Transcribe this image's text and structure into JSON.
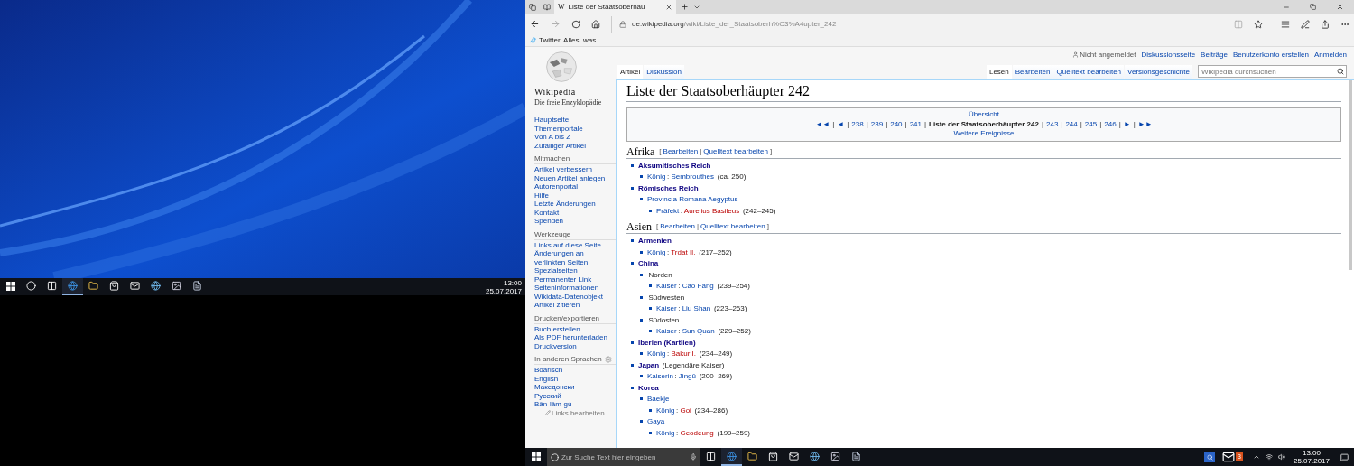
{
  "desktop": {
    "taskbar": {
      "icons": [
        {
          "kind": "start",
          "selected": false
        },
        {
          "kind": "cortana",
          "selected": false
        },
        {
          "kind": "taskview",
          "selected": false
        },
        {
          "kind": "edge",
          "selected": true
        },
        {
          "kind": "explorer",
          "selected": false
        },
        {
          "kind": "store",
          "selected": false
        },
        {
          "kind": "mail",
          "selected": false
        },
        {
          "kind": "ie",
          "selected": false
        },
        {
          "kind": "app",
          "selected": false
        },
        {
          "kind": "notepad",
          "selected": false
        }
      ],
      "time": "13:00",
      "date": "25.07.2017"
    }
  },
  "browser": {
    "tab": {
      "favicon": "W",
      "title": "Liste der Staatsoberhäu"
    },
    "address": {
      "domain": "de.wikipedia.org",
      "path": "/wiki/Liste_der_Staatsoberh%C3%A4upter_242"
    },
    "favorites": [
      {
        "label": "Twitter. Alles, was"
      }
    ]
  },
  "wiki": {
    "wordmark": "Wikipedia",
    "tagline": "Die freie Enzyklopädie",
    "personal": [
      {
        "label": "Nicht angemeldet",
        "kind": "user"
      },
      {
        "label": "Diskussionsseite",
        "kind": "link"
      },
      {
        "label": "Beiträge",
        "kind": "link"
      },
      {
        "label": "Benutzerkonto erstellen",
        "kind": "link"
      },
      {
        "label": "Anmelden",
        "kind": "link"
      }
    ],
    "left_tabs": [
      {
        "label": "Artikel",
        "selected": true
      },
      {
        "label": "Diskussion",
        "selected": false
      }
    ],
    "right_tabs": [
      {
        "label": "Lesen",
        "selected": true
      },
      {
        "label": "Bearbeiten",
        "selected": false
      },
      {
        "label": "Quelltext bearbeiten",
        "selected": false
      },
      {
        "label": "Versionsgeschichte",
        "selected": false
      }
    ],
    "search": {
      "placeholder": "Wikipedia durchsuchen"
    },
    "sidebar": [
      {
        "items": [
          "Hauptseite",
          "Themenportale",
          "Von A bis Z",
          "Zufälliger Artikel"
        ]
      },
      {
        "heading": "Mitmachen",
        "items": [
          "Artikel verbessern",
          "Neuen Artikel anlegen",
          "Autorenportal",
          "Hilfe",
          "Letzte Änderungen",
          "Kontakt",
          "Spenden"
        ]
      },
      {
        "heading": "Werkzeuge",
        "items": [
          "Links auf diese Seite",
          "Änderungen an verlinkten Seiten",
          "Spezialseiten",
          "Permanenter Link",
          "Seiteninformationen",
          "Wikidata-Datenobjekt",
          "Artikel zitieren"
        ]
      },
      {
        "heading": "Drucken/exportieren",
        "items": [
          "Buch erstellen",
          "Als PDF herunterladen",
          "Druckversion"
        ]
      },
      {
        "heading": "In anderen Sprachen",
        "gear": true,
        "items": [
          "Boarisch",
          "English",
          "Македонски",
          "Русский",
          "Bân-lâm-gú"
        ],
        "footer": "Links bearbeiten"
      }
    ],
    "title": "Liste der Staatsoberhäupter 242",
    "navbox": {
      "top": "Übersicht",
      "items": [
        {
          "text": "◄◄",
          "kind": "link"
        },
        {
          "text": "|",
          "kind": "sep"
        },
        {
          "text": "◄",
          "kind": "link"
        },
        {
          "text": "|",
          "kind": "sep"
        },
        {
          "text": "238",
          "kind": "link"
        },
        {
          "text": "|",
          "kind": "sep"
        },
        {
          "text": "239",
          "kind": "link"
        },
        {
          "text": "|",
          "kind": "sep"
        },
        {
          "text": "240",
          "kind": "link"
        },
        {
          "text": "|",
          "kind": "sep"
        },
        {
          "text": "241",
          "kind": "link"
        },
        {
          "text": "|",
          "kind": "sep"
        },
        {
          "text": "Liste der Staatsoberhäupter 242",
          "kind": "current"
        },
        {
          "text": "|",
          "kind": "sep"
        },
        {
          "text": "243",
          "kind": "link"
        },
        {
          "text": "|",
          "kind": "sep"
        },
        {
          "text": "244",
          "kind": "link"
        },
        {
          "text": "|",
          "kind": "sep"
        },
        {
          "text": "245",
          "kind": "link"
        },
        {
          "text": "|",
          "kind": "sep"
        },
        {
          "text": "246",
          "kind": "link"
        },
        {
          "text": "|",
          "kind": "sep"
        },
        {
          "text": "►",
          "kind": "link"
        },
        {
          "text": "|",
          "kind": "sep"
        },
        {
          "text": "►►",
          "kind": "link"
        }
      ],
      "bottom": "Weitere Ereignisse"
    },
    "sections": [
      {
        "heading": "Afrika",
        "edit": [
          {
            "text": "[",
            "kind": "text"
          },
          {
            "text": "Bearbeiten",
            "kind": "link"
          },
          {
            "text": "|",
            "kind": "text"
          },
          {
            "text": "Quelltext bearbeiten",
            "kind": "link"
          },
          {
            "text": "]",
            "kind": "text"
          }
        ],
        "items": [
          {
            "parts": [
              {
                "text": "Aksumitisches Reich",
                "kind": "bold"
              }
            ],
            "children": [
              {
                "parts": [
                  {
                    "text": "König",
                    "kind": "link"
                  },
                  {
                    "text": ": ",
                    "kind": "text"
                  },
                  {
                    "text": "Sembrouthes",
                    "kind": "link"
                  },
                  {
                    "text": " (ca. 250)",
                    "kind": "text"
                  }
                ]
              }
            ]
          },
          {
            "parts": [
              {
                "text": "Römisches Reich",
                "kind": "bold"
              }
            ],
            "children": [
              {
                "parts": [
                  {
                    "text": "Provincia Romana Aegyptus",
                    "kind": "link"
                  }
                ],
                "children": [
                  {
                    "parts": [
                      {
                        "text": "Präfekt",
                        "kind": "link"
                      },
                      {
                        "text": ": ",
                        "kind": "text"
                      },
                      {
                        "text": "Aurelius Basileus",
                        "kind": "red"
                      },
                      {
                        "text": " (242–245)",
                        "kind": "text"
                      }
                    ]
                  }
                ]
              }
            ]
          }
        ]
      },
      {
        "heading": "Asien",
        "edit": [
          {
            "text": "[",
            "kind": "text"
          },
          {
            "text": "Bearbeiten",
            "kind": "link"
          },
          {
            "text": "|",
            "kind": "text"
          },
          {
            "text": "Quelltext bearbeiten",
            "kind": "link"
          },
          {
            "text": "]",
            "kind": "text"
          }
        ],
        "items": [
          {
            "parts": [
              {
                "text": "Armenien",
                "kind": "bold"
              }
            ],
            "children": [
              {
                "parts": [
                  {
                    "text": "König",
                    "kind": "link"
                  },
                  {
                    "text": ": ",
                    "kind": "text"
                  },
                  {
                    "text": "Trdat II.",
                    "kind": "red"
                  },
                  {
                    "text": " (217–252)",
                    "kind": "text"
                  }
                ]
              }
            ]
          },
          {
            "parts": [
              {
                "text": "China",
                "kind": "bold"
              }
            ],
            "children": [
              {
                "parts": [
                  {
                    "text": "Norden",
                    "kind": "text"
                  }
                ],
                "children": [
                  {
                    "parts": [
                      {
                        "text": "Kaiser",
                        "kind": "link"
                      },
                      {
                        "text": ": ",
                        "kind": "text"
                      },
                      {
                        "text": "Cao Fang",
                        "kind": "link"
                      },
                      {
                        "text": " (239–254)",
                        "kind": "text"
                      }
                    ]
                  }
                ]
              },
              {
                "parts": [
                  {
                    "text": "Südwesten",
                    "kind": "text"
                  }
                ],
                "children": [
                  {
                    "parts": [
                      {
                        "text": "Kaiser",
                        "kind": "link"
                      },
                      {
                        "text": ": ",
                        "kind": "text"
                      },
                      {
                        "text": "Liu Shan",
                        "kind": "link"
                      },
                      {
                        "text": " (223–263)",
                        "kind": "text"
                      }
                    ]
                  }
                ]
              },
              {
                "parts": [
                  {
                    "text": "Südosten",
                    "kind": "text"
                  }
                ],
                "children": [
                  {
                    "parts": [
                      {
                        "text": "Kaiser",
                        "kind": "link"
                      },
                      {
                        "text": ": ",
                        "kind": "text"
                      },
                      {
                        "text": "Sun Quan",
                        "kind": "link"
                      },
                      {
                        "text": " (229–252)",
                        "kind": "text"
                      }
                    ]
                  }
                ]
              }
            ]
          },
          {
            "parts": [
              {
                "text": "Iberien (Kartlien)",
                "kind": "bold"
              }
            ],
            "children": [
              {
                "parts": [
                  {
                    "text": "König",
                    "kind": "link"
                  },
                  {
                    "text": ": ",
                    "kind": "text"
                  },
                  {
                    "text": "Bakur I.",
                    "kind": "red"
                  },
                  {
                    "text": " (234–249)",
                    "kind": "text"
                  }
                ]
              }
            ]
          },
          {
            "parts": [
              {
                "text": "Japan",
                "kind": "bold"
              },
              {
                "text": " (Legendäre Kaiser)",
                "kind": "text"
              }
            ],
            "children": [
              {
                "parts": [
                  {
                    "text": "Kaiserin",
                    "kind": "link"
                  },
                  {
                    "text": ": ",
                    "kind": "text"
                  },
                  {
                    "text": "Jingū",
                    "kind": "link"
                  },
                  {
                    "text": " (200–269)",
                    "kind": "text"
                  }
                ]
              }
            ]
          },
          {
            "parts": [
              {
                "text": "Korea",
                "kind": "bold"
              }
            ],
            "children": [
              {
                "parts": [
                  {
                    "text": "Baekje",
                    "kind": "link"
                  }
                ],
                "children": [
                  {
                    "parts": [
                      {
                        "text": "König",
                        "kind": "link"
                      },
                      {
                        "text": ": ",
                        "kind": "text"
                      },
                      {
                        "text": "Goi",
                        "kind": "red"
                      },
                      {
                        "text": " (234–286)",
                        "kind": "text"
                      }
                    ]
                  }
                ]
              },
              {
                "parts": [
                  {
                    "text": "Gaya",
                    "kind": "link"
                  }
                ],
                "children": [
                  {
                    "parts": [
                      {
                        "text": "König",
                        "kind": "link"
                      },
                      {
                        "text": ": ",
                        "kind": "text"
                      },
                      {
                        "text": "Geodeung",
                        "kind": "red"
                      },
                      {
                        "text": " (199–259)",
                        "kind": "text"
                      }
                    ]
                  }
                ]
              }
            ]
          }
        ]
      }
    ]
  },
  "taskbar": {
    "search": {
      "placeholder": "Zur Suche Text hier eingeben"
    },
    "icons": [
      {
        "kind": "taskview",
        "selected": false
      },
      {
        "kind": "edge",
        "selected": true
      },
      {
        "kind": "explorer",
        "selected": false
      },
      {
        "kind": "store",
        "selected": false
      },
      {
        "kind": "mail",
        "selected": false
      },
      {
        "kind": "ie",
        "selected": false
      },
      {
        "kind": "app",
        "selected": false
      },
      {
        "kind": "notepad",
        "selected": false
      }
    ],
    "mail_badge": "3",
    "time": "13:00",
    "date": "25.07.2017"
  }
}
